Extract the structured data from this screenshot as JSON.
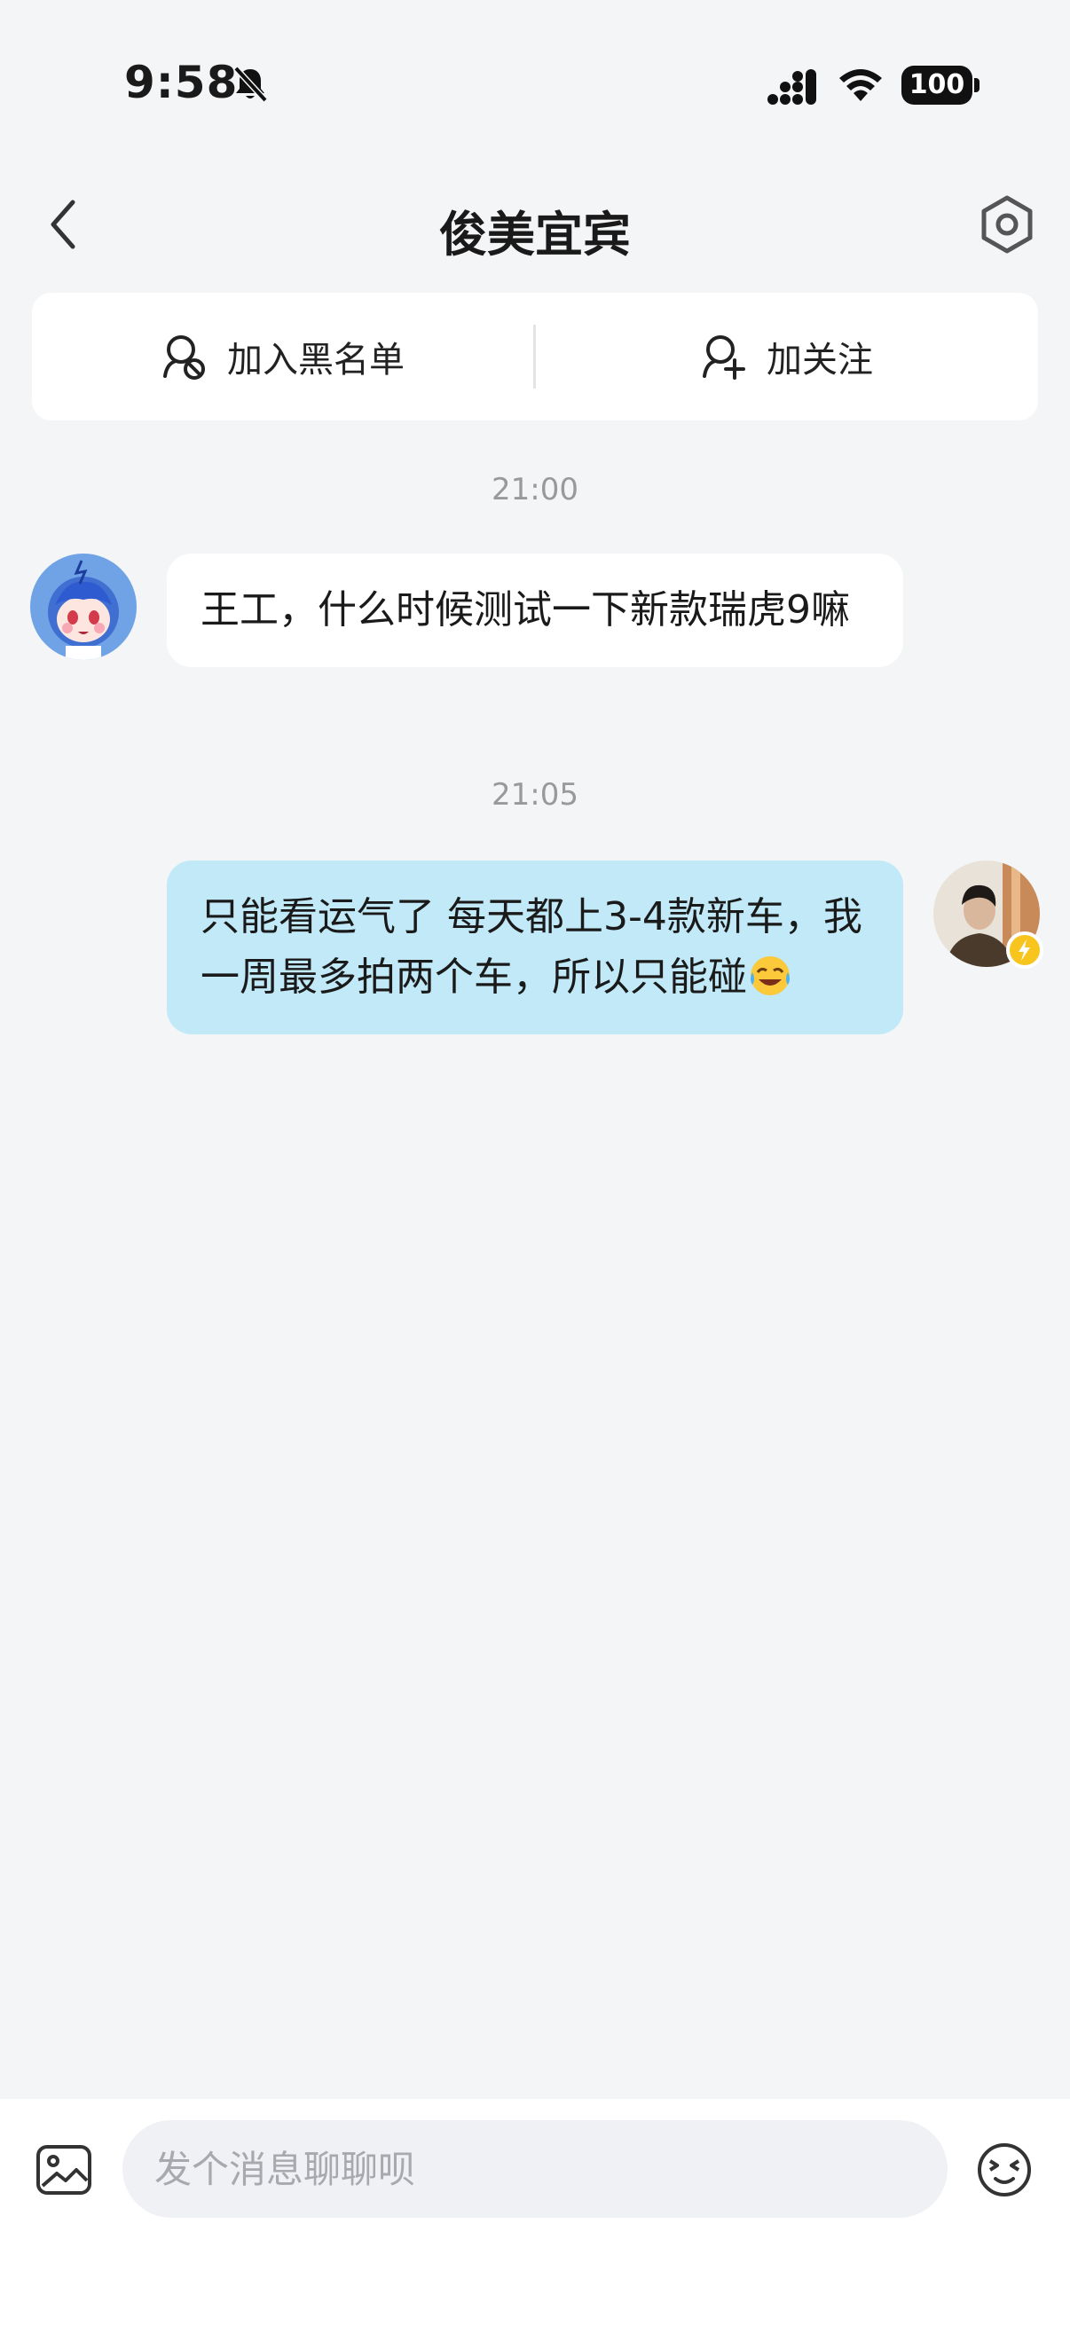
{
  "status_bar": {
    "time": "9:58",
    "battery": "100"
  },
  "nav": {
    "title": "俊美宜宾"
  },
  "actions": {
    "blacklist_label": "加入黑名单",
    "follow_label": "加关注"
  },
  "messages": [
    {
      "time": "21:00",
      "direction": "incoming",
      "text": "王工，什么时候测试一下新款瑞虎9嘛"
    },
    {
      "time": "21:05",
      "direction": "outgoing",
      "text": "只能看运气了 每天都上3-4款新车，我一周最多拍两个车，所以只能碰"
    }
  ],
  "composer": {
    "placeholder": "发个消息聊聊呗"
  },
  "colors": {
    "background": "#f4f5f7",
    "outgoing_bubble": "#c1e9f7",
    "incoming_bubble": "#ffffff",
    "badge": "#f7c51e"
  },
  "icons": [
    "mute-icon",
    "signal-icon",
    "wifi-icon",
    "back-icon",
    "settings-icon",
    "block-user-icon",
    "add-user-icon",
    "image-icon",
    "emoji-icon",
    "lightning-icon"
  ]
}
